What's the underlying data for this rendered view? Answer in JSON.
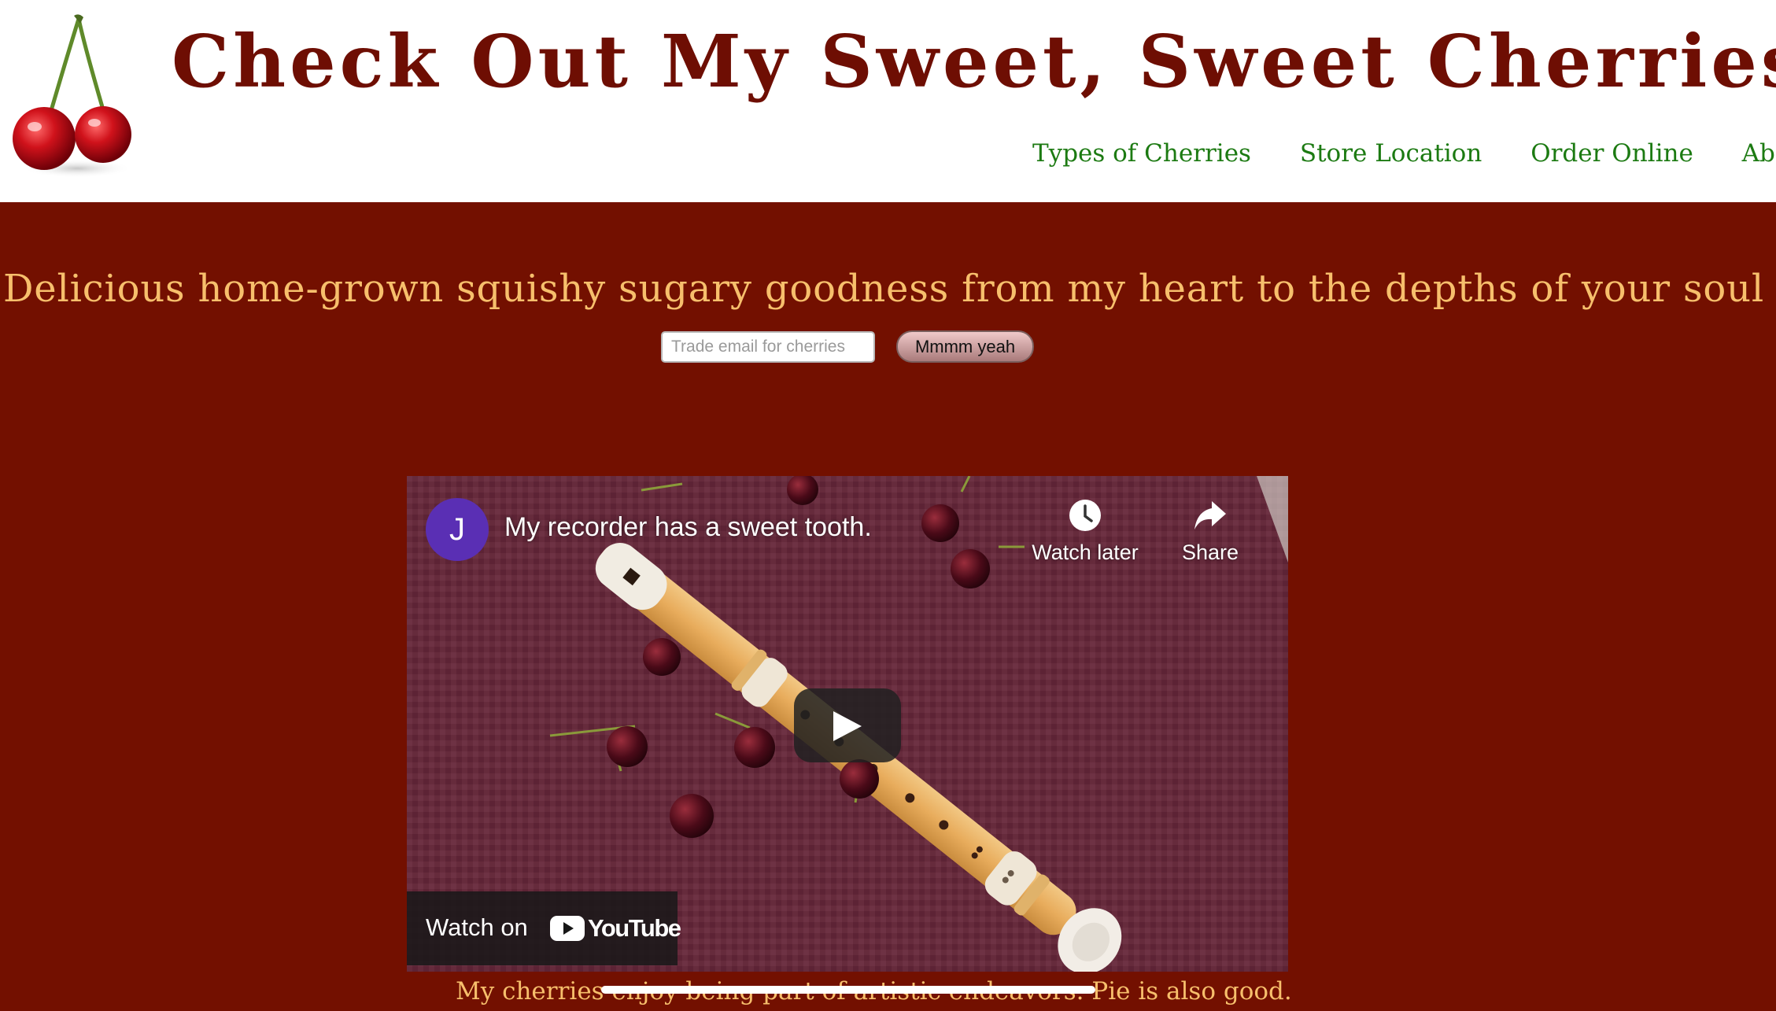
{
  "header": {
    "title": "Check Out My Sweet, Sweet Cherries",
    "logo_icon": "cherries-icon",
    "nav": [
      "Types of Cherries",
      "Store Location",
      "Order Online",
      "About Us"
    ]
  },
  "hero": {
    "tagline": "Delicious home-grown squishy sugary goodness from my heart to the depths of your soul",
    "email_placeholder": "Trade email for cherries",
    "email_value": "",
    "submit_label": "Mmmm yeah"
  },
  "video": {
    "channel_initial": "J",
    "title": "My recorder has a sweet tooth.",
    "watch_later_label": "Watch later",
    "share_label": "Share",
    "watch_on_label": "Watch on",
    "youtube_label": "YouTube",
    "play_icon": "play-icon",
    "watch_later_icon": "clock-icon",
    "share_icon": "share-arrow-icon",
    "youtube_icon": "youtube-logo-icon"
  },
  "caption": "My cherries enjoy being part of artistic endeavors. Pie is also good.",
  "colors": {
    "page_background": "#731000",
    "title": "#6e0e03",
    "nav": "#1c7a12",
    "accent_text": "#f7bf6c",
    "youtube_red": "#ff0000"
  }
}
